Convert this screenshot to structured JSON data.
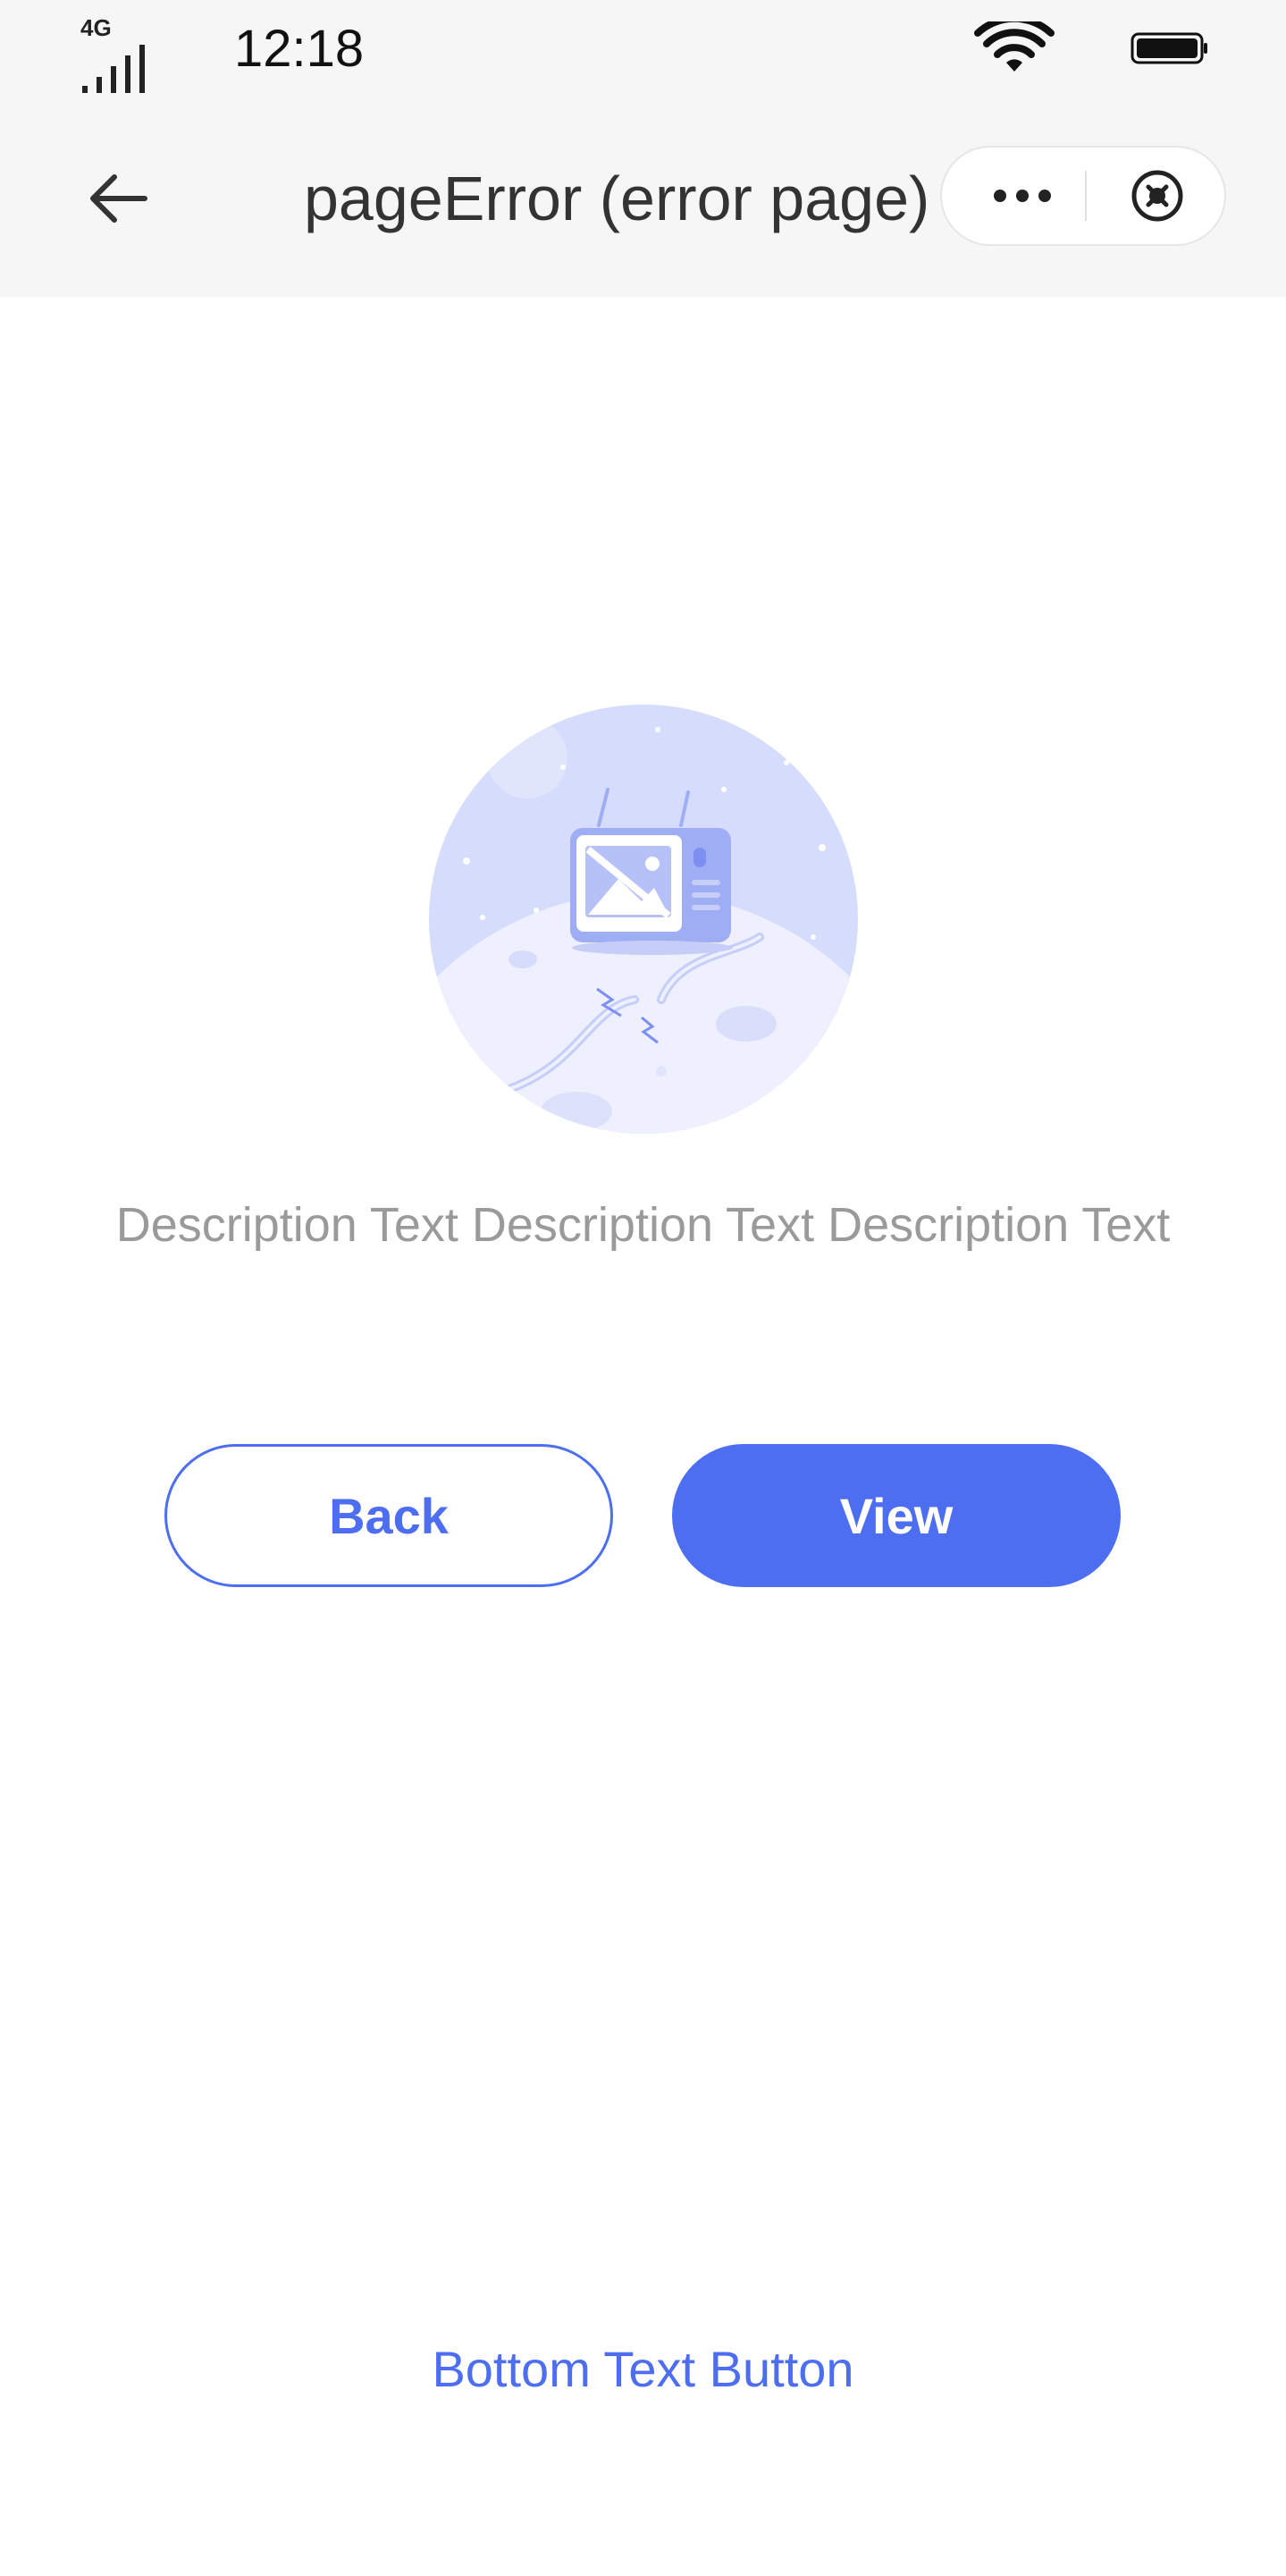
{
  "status_bar": {
    "network": "4G",
    "time": "12:18",
    "signal_icon": "signal-bars-icon",
    "wifi_icon": "wifi-icon",
    "battery_icon": "battery-icon"
  },
  "nav_bar": {
    "title": "pageError (error page)",
    "back_icon": "arrow-left-icon",
    "more_icon": "more-dots-icon",
    "close_icon": "close-circle-icon"
  },
  "content": {
    "illustration_icon": "broken-tv-on-moon-illustration",
    "description": "Description Text Description Text Description Text",
    "back_label": "Back",
    "view_label": "View",
    "bottom_link_label": "Bottom Text Button"
  },
  "colors": {
    "accent": "#4e6ef2",
    "bar_background": "#f6f6f6",
    "description_text": "#9a9a9a",
    "illustration_bg": "#d6dcfb"
  }
}
